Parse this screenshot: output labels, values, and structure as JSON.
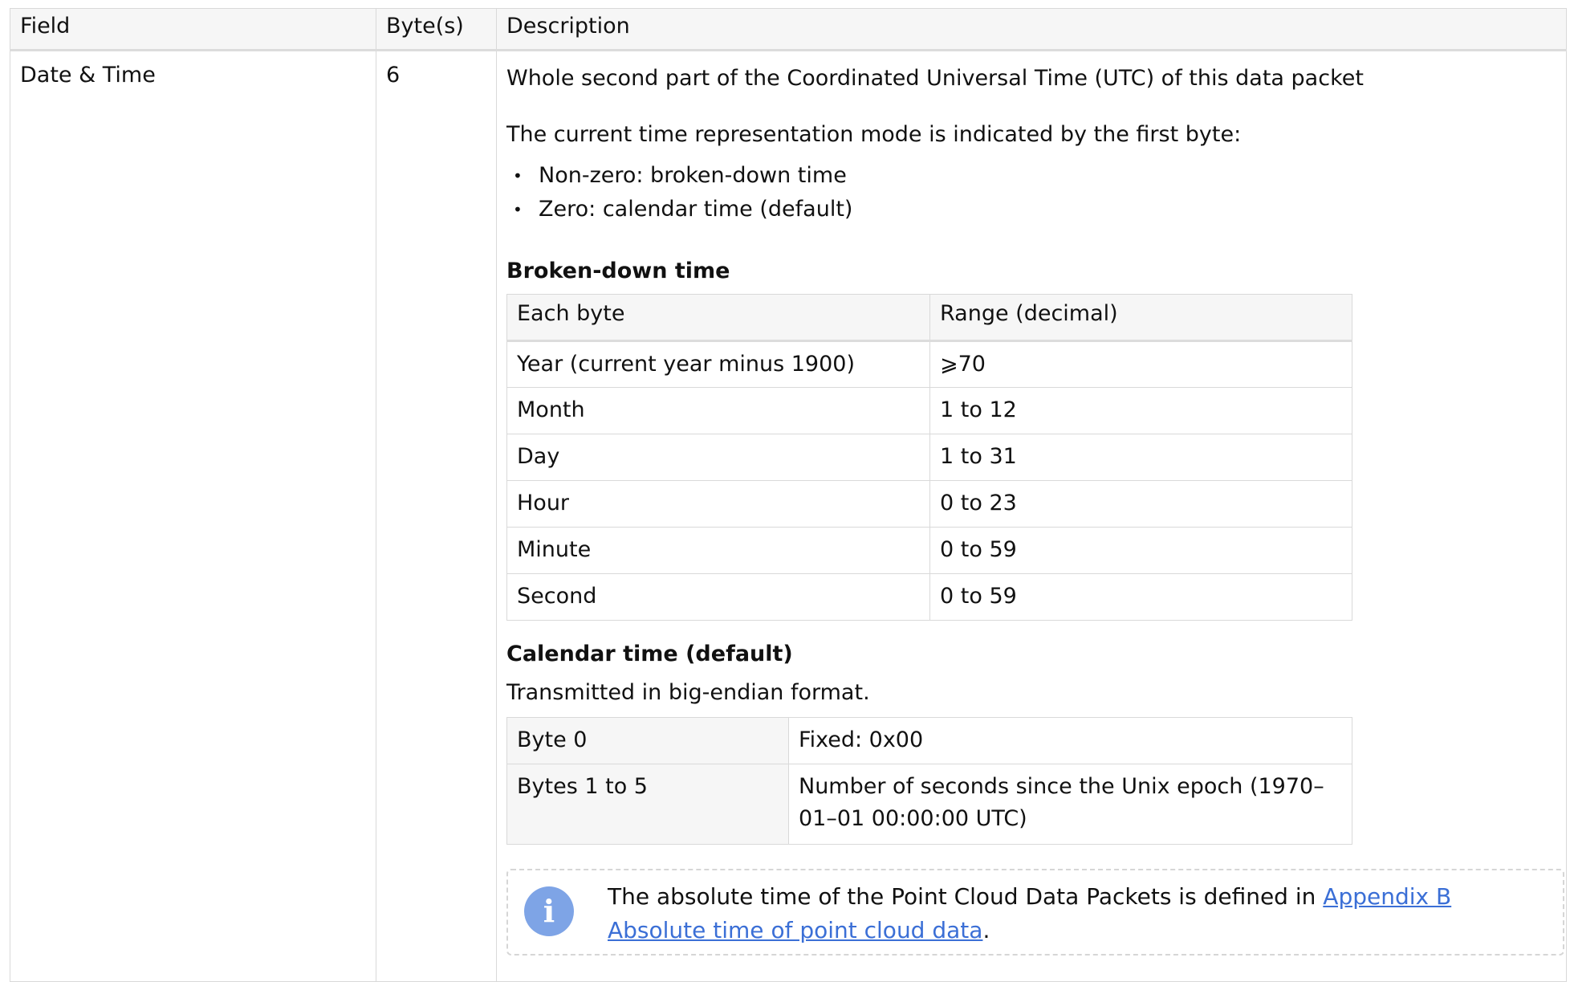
{
  "header": {
    "field": "Field",
    "bytes": "Byte(s)",
    "description": "Description"
  },
  "row": {
    "field": "Date & Time",
    "bytes": "6",
    "intro": "Whole second part of the Coordinated Universal Time (UTC) of this data packet",
    "mode_text": "The current time representation mode is indicated by the first byte:",
    "modes": [
      "Non-zero: broken-down time",
      "Zero: calendar time (default)"
    ],
    "broken_down": {
      "heading": "Broken-down time",
      "columns": [
        "Each byte",
        "Range (decimal)"
      ],
      "rows": [
        [
          "Year (current year minus 1900)",
          "⩾70"
        ],
        [
          "Month",
          "1 to 12"
        ],
        [
          "Day",
          "1 to 31"
        ],
        [
          "Hour",
          "0 to 23"
        ],
        [
          "Minute",
          "0 to 59"
        ],
        [
          "Second",
          "0 to 59"
        ]
      ]
    },
    "calendar": {
      "heading": "Calendar time (default)",
      "text": "Transmitted in big-endian format.",
      "rows": [
        [
          "Byte 0",
          "Fixed: 0x00"
        ],
        [
          "Bytes 1 to 5",
          "Number of seconds since the Unix epoch (1970–01–01 00:00:00 UTC)"
        ]
      ]
    },
    "note": {
      "icon": "info-icon",
      "text": "The absolute time of the Point Cloud Data Packets is defined in ",
      "link": "Appendix B Absolute time of point cloud data",
      "suffix": "."
    }
  },
  "colors": {
    "link": "#3b6fd6",
    "info_icon": "#7ea4e6",
    "header_bg": "#f6f6f6",
    "border": "#d9d9d9"
  }
}
